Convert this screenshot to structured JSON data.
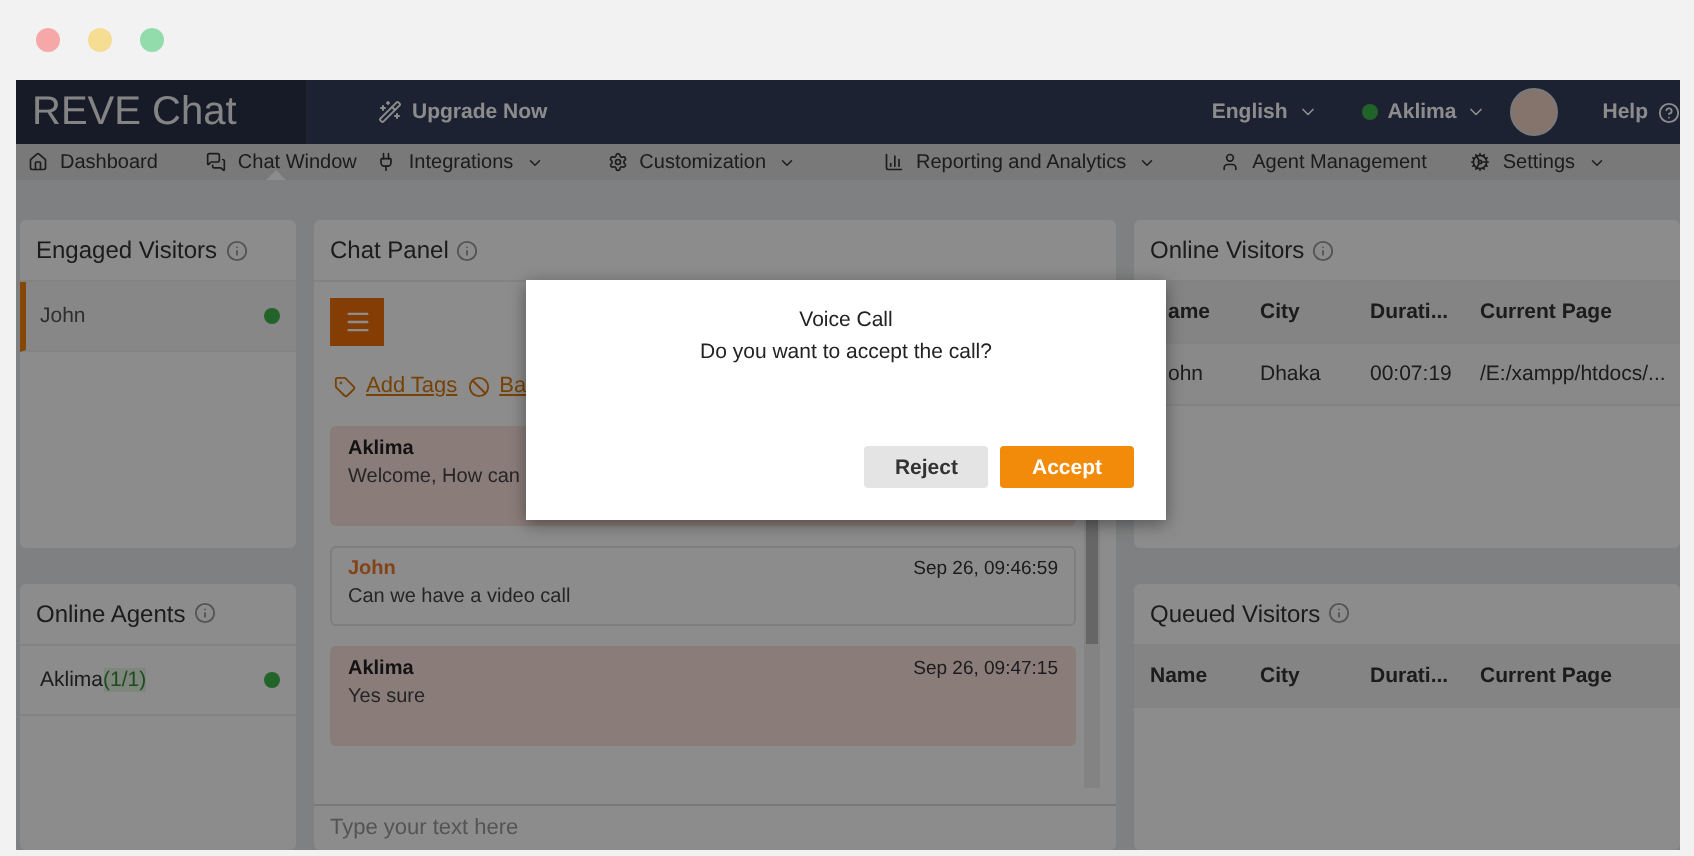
{
  "header": {
    "logo": "REVE Chat",
    "upgrade": "Upgrade Now",
    "language": "English",
    "agent": {
      "name": "Aklima",
      "online": true
    },
    "help": "Help"
  },
  "nav": [
    {
      "label": "Dashboard",
      "dropdown": false,
      "selected": false
    },
    {
      "label": "Chat Window",
      "dropdown": false,
      "selected": true
    },
    {
      "label": "Integrations",
      "dropdown": true,
      "selected": false
    },
    {
      "label": "Customization",
      "dropdown": true,
      "selected": false
    },
    {
      "label": "Reporting and Analytics",
      "dropdown": true,
      "selected": false
    },
    {
      "label": "Agent Management",
      "dropdown": false,
      "selected": false
    },
    {
      "label": "Settings",
      "dropdown": true,
      "selected": false
    }
  ],
  "engaged_visitors": {
    "title": "Engaged Visitors",
    "visitors": [
      {
        "name": "John",
        "online": true,
        "selected": true
      }
    ]
  },
  "online_agents": {
    "title": "Online Agents",
    "agents": [
      {
        "name": "Aklima",
        "count": "(1/1)",
        "online": true
      }
    ]
  },
  "chat_panel": {
    "title": "Chat Panel",
    "add_tags": "Add Tags",
    "ban": "Ba",
    "messages": [
      {
        "kind": "agent",
        "sender": "Aklima",
        "text": "Welcome, How can"
      },
      {
        "kind": "visitor",
        "sender": "John",
        "time": "Sep 26, 09:46:59",
        "text": "Can we have a video call"
      },
      {
        "kind": "agent",
        "sender": "Aklima",
        "time": "Sep 26, 09:47:15",
        "text": "Yes sure"
      }
    ],
    "input": {
      "placeholder": "Type your text here"
    }
  },
  "online_visitors": {
    "title": "Online Visitors",
    "columns": [
      "ame",
      "City",
      "Durati...",
      "Current Page"
    ],
    "rows": [
      [
        "ohn",
        "Dhaka",
        "00:07:19",
        "/E:/xampp/htdocs/..."
      ]
    ]
  },
  "queued_visitors": {
    "title": "Queued Visitors",
    "columns": [
      "Name",
      "City",
      "Durati...",
      "Current Page"
    ]
  },
  "modal": {
    "title": "Voice Call",
    "message": "Do you want to accept the call?",
    "buttons": [
      {
        "label": "Reject",
        "kind": "secondary"
      },
      {
        "label": "Accept",
        "kind": "primary"
      }
    ]
  }
}
